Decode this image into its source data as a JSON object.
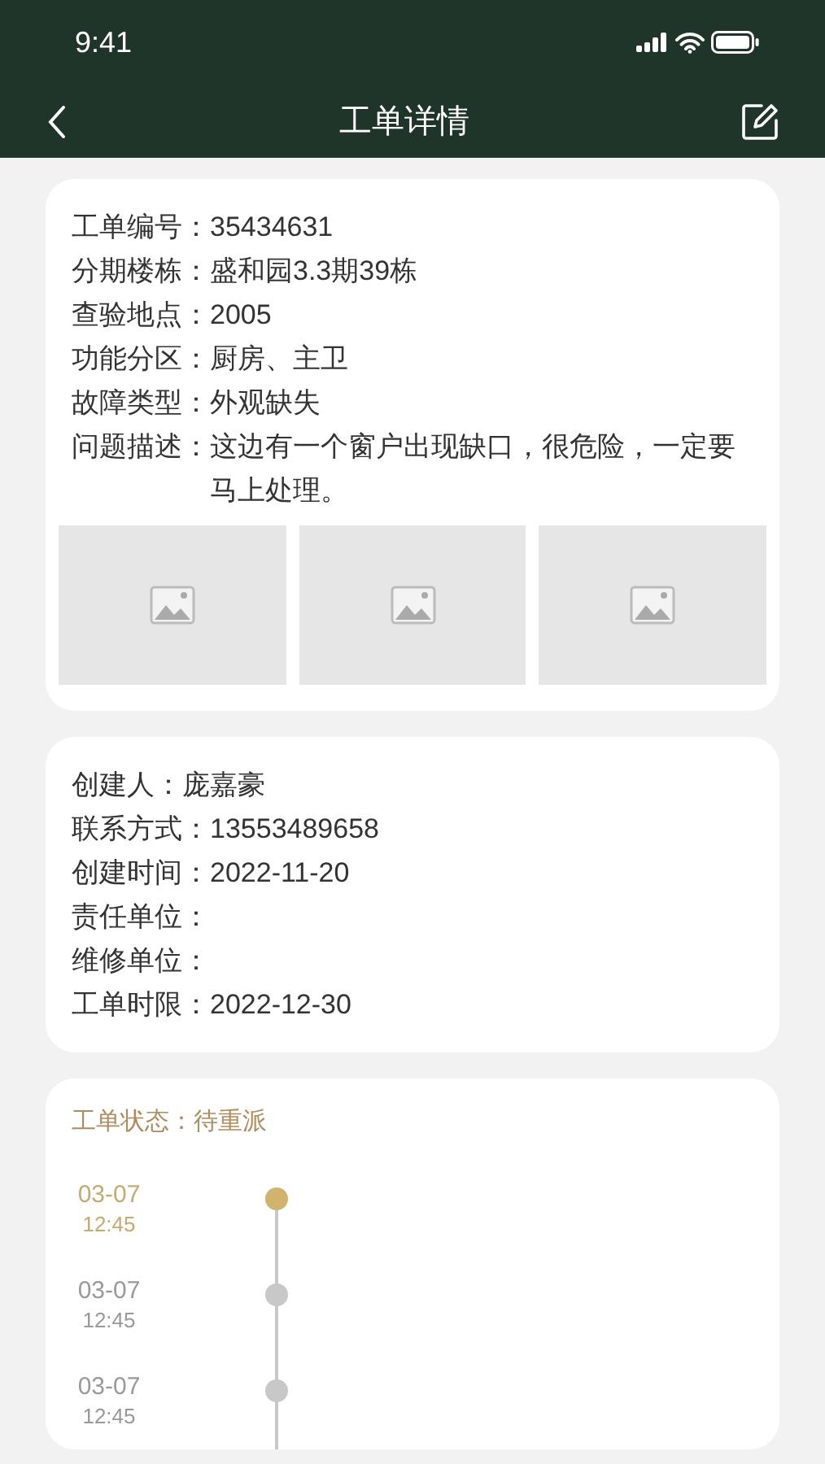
{
  "status_bar": {
    "time": "9:41"
  },
  "nav_bar": {
    "title": "工单详情"
  },
  "order_card": {
    "fields": [
      {
        "label": "工单编号：",
        "value": "35434631"
      },
      {
        "label": "分期楼栋：",
        "value": "盛和园3.3期39栋"
      },
      {
        "label": "查验地点：",
        "value": "2005"
      },
      {
        "label": "功能分区：",
        "value": "厨房、主卫"
      },
      {
        "label": "故障类型：",
        "value": "外观缺失"
      },
      {
        "label": "问题描述：",
        "value": "这边有一个窗户出现缺口，很危险，一定要马上处理。"
      }
    ],
    "photos": [
      {
        "kind": "placeholder"
      },
      {
        "kind": "placeholder"
      },
      {
        "kind": "placeholder"
      }
    ]
  },
  "creator_card": {
    "fields": [
      {
        "label": "创建人：",
        "value": "庞嘉豪"
      },
      {
        "label": "联系方式：",
        "value": "13553489658"
      },
      {
        "label": "创建时间：",
        "value": "2022-11-20"
      },
      {
        "label": "责任单位："
      },
      {
        "label": "维修单位："
      },
      {
        "label": "工单时限：",
        "value": "2022-12-30"
      }
    ]
  },
  "status_card": {
    "status": "工单状态：待重派",
    "timeline": [
      {
        "date": "03-07",
        "time": "12:45",
        "selected": true
      },
      {
        "date": "03-07",
        "time": "12:45",
        "selected": false
      },
      {
        "date": "03-07",
        "time": "12:45",
        "selected": false
      }
    ]
  }
}
